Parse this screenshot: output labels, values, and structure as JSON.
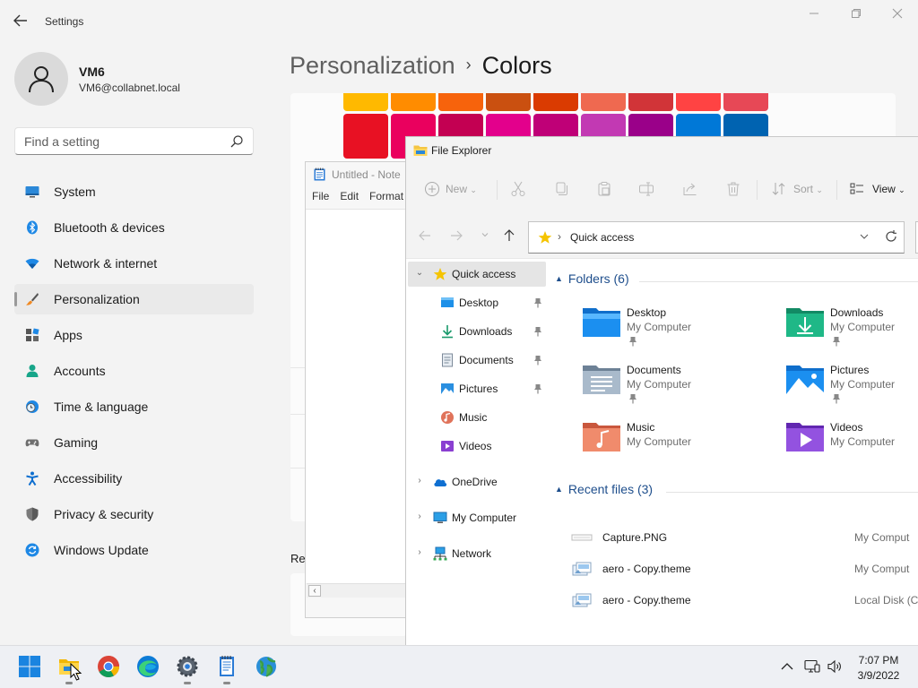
{
  "settings": {
    "window_title": "Settings",
    "user": {
      "name": "VM6",
      "email": "VM6@collabnet.local"
    },
    "search": {
      "placeholder": "Find a setting",
      "value": ""
    },
    "nav": [
      {
        "label": "System",
        "icon": "monitor-icon"
      },
      {
        "label": "Bluetooth & devices",
        "icon": "bluetooth-icon"
      },
      {
        "label": "Network & internet",
        "icon": "wifi-icon"
      },
      {
        "label": "Personalization",
        "icon": "brush-icon",
        "active": true
      },
      {
        "label": "Apps",
        "icon": "apps-icon"
      },
      {
        "label": "Accounts",
        "icon": "person-icon"
      },
      {
        "label": "Time & language",
        "icon": "clock-globe-icon"
      },
      {
        "label": "Gaming",
        "icon": "gamepad-icon"
      },
      {
        "label": "Accessibility",
        "icon": "accessibility-icon"
      },
      {
        "label": "Privacy & security",
        "icon": "shield-icon"
      },
      {
        "label": "Windows Update",
        "icon": "update-icon"
      }
    ],
    "breadcrumb": {
      "parent": "Personalization",
      "separator": "›",
      "current": "Colors"
    },
    "related_label": "Re",
    "swatches_row0": [
      "#ffb900",
      "#ff8c00",
      "#f7630c",
      "#ca5010",
      "#da3b01",
      "#ef6950",
      "#d13438",
      "#ff4343",
      "#e74856"
    ],
    "swatches_row1": [
      "#e81123",
      "#ea005e",
      "#c30052",
      "#e3008c",
      "#bf0077",
      "#c239b3",
      "#9a0089",
      "#0078d7",
      "#0063b1"
    ]
  },
  "notepad": {
    "title": "Untitled - Note",
    "menu": [
      "File",
      "Edit",
      "Format"
    ]
  },
  "explorer": {
    "title": "File Explorer",
    "toolbar": {
      "new_label": "New",
      "sort_label": "Sort",
      "view_label": "View"
    },
    "address": "Quick access",
    "tree": [
      {
        "label": "Quick access",
        "icon": "star-icon",
        "level": 0,
        "chevron": "⌄",
        "selected": true
      },
      {
        "label": "Desktop",
        "icon": "desktop-folder-icon",
        "level": 1,
        "pinned": true
      },
      {
        "label": "Downloads",
        "icon": "download-icon",
        "level": 1,
        "pinned": true
      },
      {
        "label": "Documents",
        "icon": "documents-icon",
        "level": 1,
        "pinned": true
      },
      {
        "label": "Pictures",
        "icon": "pictures-icon",
        "level": 1,
        "pinned": true
      },
      {
        "label": "Music",
        "icon": "music-icon",
        "level": 1
      },
      {
        "label": "Videos",
        "icon": "videos-icon",
        "level": 1
      },
      {
        "label": "OneDrive",
        "icon": "cloud-icon",
        "level": 0,
        "chevron": "›"
      },
      {
        "label": "My Computer",
        "icon": "computer-icon",
        "level": 0,
        "chevron": "›"
      },
      {
        "label": "Network",
        "icon": "network-icon",
        "level": 0,
        "chevron": "›"
      }
    ],
    "folders_header": "Folders (6)",
    "folders": [
      {
        "name": "Desktop",
        "location": "My Computer",
        "pinned": true,
        "icon": "desktop-folder-icon"
      },
      {
        "name": "Downloads",
        "location": "My Computer",
        "pinned": true,
        "icon": "downloads-folder-icon"
      },
      {
        "name": "Documents",
        "location": "My Computer",
        "pinned": true,
        "icon": "documents-folder-icon"
      },
      {
        "name": "Pictures",
        "location": "My Computer",
        "pinned": true,
        "icon": "pictures-folder-icon"
      },
      {
        "name": "Music",
        "location": "My Computer",
        "pinned": false,
        "icon": "music-folder-icon"
      },
      {
        "name": "Videos",
        "location": "My Computer",
        "pinned": false,
        "icon": "videos-folder-icon"
      }
    ],
    "recent_header": "Recent files (3)",
    "recent": [
      {
        "name": "Capture.PNG",
        "location": "My Comput",
        "icon": "image-file-icon"
      },
      {
        "name": "aero - Copy.theme",
        "location": "My Comput",
        "icon": "theme-file-icon"
      },
      {
        "name": "aero - Copy.theme",
        "location": "Local Disk (C",
        "icon": "theme-file-icon"
      }
    ]
  },
  "taskbar": {
    "apps": [
      "start-icon",
      "file-explorer-icon",
      "chrome-icon",
      "edge-icon",
      "settings-gear-icon",
      "notepad-icon",
      "globe-app-icon"
    ],
    "time": "7:07 PM",
    "date": "3/9/2022"
  }
}
